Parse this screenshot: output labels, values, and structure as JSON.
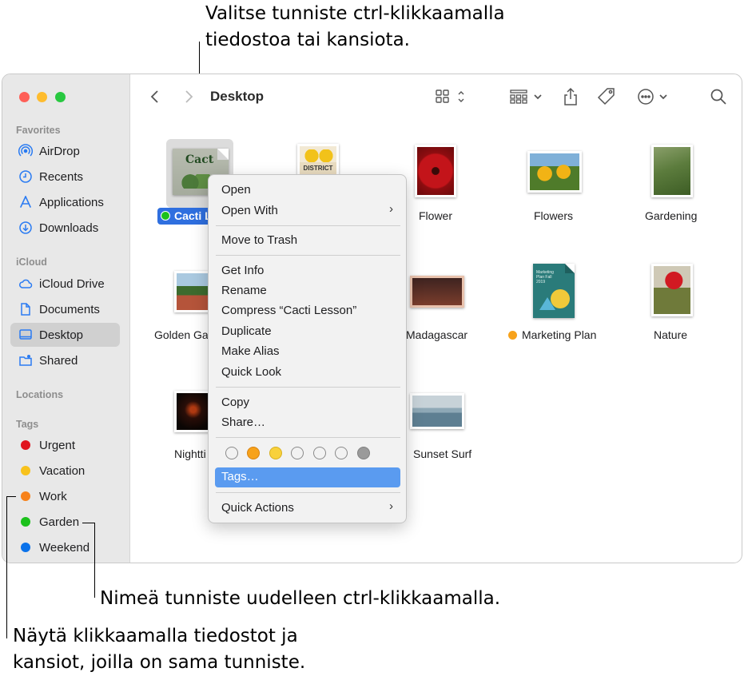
{
  "annotations": {
    "top_line1": "Valitse tunniste ctrl-klikkaamalla",
    "top_line2": "tiedostoa tai kansiota.",
    "rename": "Nimeä tunniste uudelleen ctrl-klikkaamalla.",
    "bottom_line1": "Näytä klikkaamalla tiedostot ja",
    "bottom_line2": "kansiot, joilla on sama tunniste."
  },
  "window": {
    "title": "Desktop"
  },
  "sidebar": {
    "favorites_header": "Favorites",
    "favorites": [
      "AirDrop",
      "Recents",
      "Applications",
      "Downloads"
    ],
    "icloud_header": "iCloud",
    "icloud": [
      "iCloud Drive",
      "Documents",
      "Desktop",
      "Shared"
    ],
    "locations_header": "Locations",
    "tags_header": "Tags",
    "tags": [
      "Urgent",
      "Vacation",
      "Work",
      "Garden",
      "Weekend"
    ]
  },
  "files": {
    "cacti": "Cacti L",
    "flower": "Flower",
    "flowers": "Flowers",
    "gardening": "Gardening",
    "golden": "Golden Ga",
    "madagascar": "Madagascar",
    "marketing": "Marketing Plan",
    "nature": "Nature",
    "nighttime": "Nightti",
    "sunset": "Sunset Surf",
    "cacti_thumb_text": "Cact",
    "district_thumb_text": "DISTRICT",
    "marketing_thumb_text": "Marketing Plan Fall 2019"
  },
  "menu": {
    "open": "Open",
    "open_with": "Open With",
    "trash": "Move to Trash",
    "get_info": "Get Info",
    "rename": "Rename",
    "compress": "Compress “Cacti Lesson”",
    "duplicate": "Duplicate",
    "alias": "Make Alias",
    "quick_look": "Quick Look",
    "copy": "Copy",
    "share": "Share…",
    "tags": "Tags…",
    "quick_actions": "Quick Actions"
  },
  "colors": {
    "red": "#e0141e",
    "orange": "#f7821b",
    "yellow": "#f8c21c",
    "green": "#1cc11c",
    "blue": "#0a72ea",
    "gray": "#9a9a9a",
    "accent": "#3b82f0",
    "menu_highlight": "#5a9bf0"
  }
}
